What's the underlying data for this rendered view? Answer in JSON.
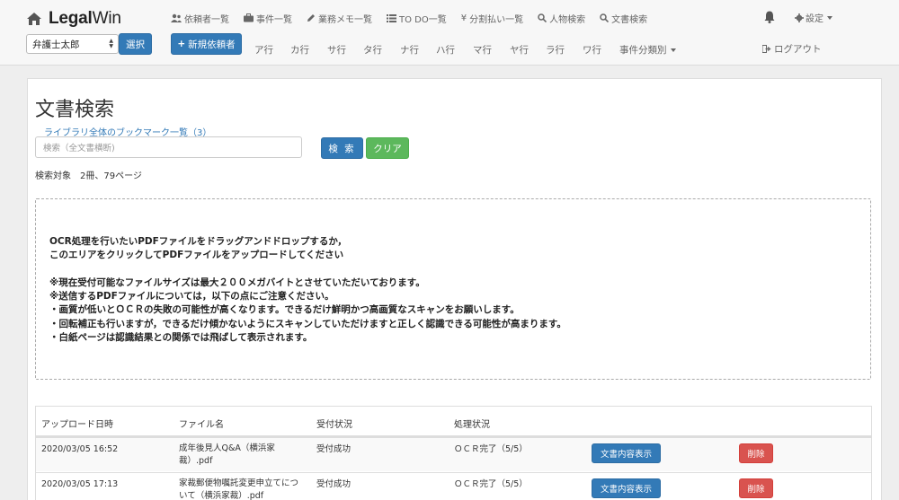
{
  "brand": {
    "name_bold": "Legal",
    "name_light": "Win"
  },
  "topnav": [
    {
      "label": "依頼者一覧",
      "icon": "users-icon"
    },
    {
      "label": "事件一覧",
      "icon": "briefcase-icon"
    },
    {
      "label": "業務メモ一覧",
      "icon": "pencil-icon"
    },
    {
      "label": "TO DO一覧",
      "icon": "list-icon"
    },
    {
      "label": "分割払い一覧",
      "icon": "yen-icon"
    },
    {
      "label": "人物検索",
      "icon": "search-icon"
    },
    {
      "label": "文書検索",
      "icon": "search-icon"
    }
  ],
  "settings_label": "設定",
  "lawyer_select": {
    "value": "弁護士太郎"
  },
  "select_button": "選択",
  "new_client_button": "新規依頼者",
  "kana_nav": [
    "ア行",
    "カ行",
    "サ行",
    "タ行",
    "ナ行",
    "ハ行",
    "マ行",
    "ヤ行",
    "ラ行",
    "ワ行"
  ],
  "case_category_label": "事件分類別",
  "logout_label": "ログアウト",
  "page": {
    "title": "文書検索",
    "bookmark_link": "ライブラリ全体のブックマーク一覧（3）",
    "search_placeholder": "検索（全文書横断)",
    "search_button": "検 索",
    "clear_button": "クリア",
    "search_target": "検索対象　2冊、79ページ"
  },
  "dropzone": {
    "lines": [
      "OCR処理を行いたいPDFファイルをドラッグアンドドロップするか，",
      "このエリアをクリックしてPDFファイルをアップロードしてください",
      "※現在受付可能なファイルサイズは最大２００メガバイトとさせていただいております。",
      "※送信するPDFファイルについては，以下の点にご注意ください。",
      "・画質が低いとＯＣＲの失敗の可能性が高くなります。できるだけ鮮明かつ高画質なスキャンをお願いします。",
      "・回転補正も行いますが，できるだけ傾かないようにスキャンしていただけますと正しく認識できる可能性が高まります。",
      "・白紙ページは認識結果との関係では飛ばして表示されます。"
    ]
  },
  "table": {
    "headers": [
      "アップロード日時",
      "ファイル名",
      "受付状況",
      "処理状況"
    ],
    "rows": [
      {
        "date": "2020/03/05 16:52",
        "file_line1": "成年後見人Q&A（横浜家",
        "file_line2": "裁）.pdf",
        "reception": "受付成功",
        "status": "ＯＣＲ完了（5/5）",
        "view_button": "文書内容表示",
        "delete_button": "削除"
      },
      {
        "date": "2020/03/05 17:13",
        "file_line1": "家裁郵便物嘱託変更申立てにつ",
        "file_line2": "いて（横浜家裁）.pdf",
        "reception": "受付成功",
        "status": "ＯＣＲ完了（5/5）",
        "view_button": "文書内容表示",
        "delete_button": "削除"
      }
    ]
  },
  "colors": {
    "primary": "#337ab7",
    "success": "#5cb85c",
    "danger": "#d9534f",
    "link": "#337ab7"
  }
}
